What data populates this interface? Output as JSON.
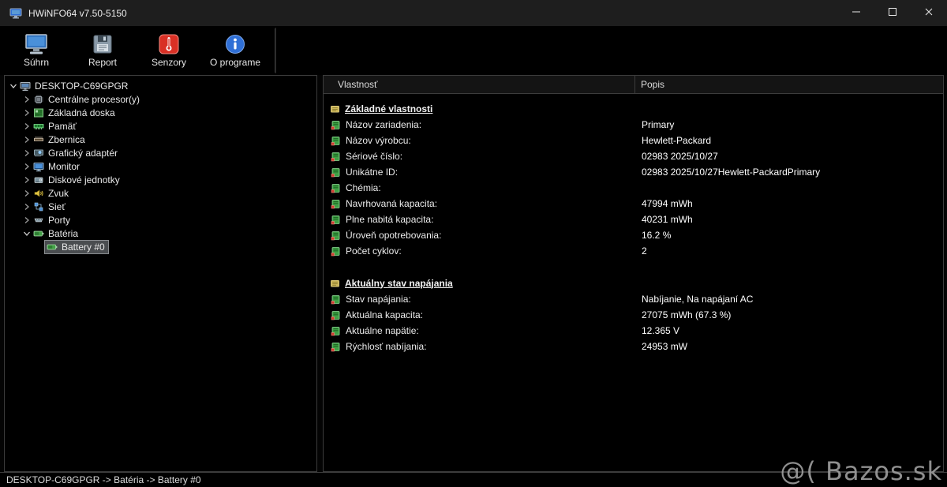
{
  "window": {
    "title": "HWiNFO64 v7.50-5150",
    "app_icon": "app-icon",
    "controls": [
      {
        "name": "minimize",
        "icon": "minimize-icon"
      },
      {
        "name": "maximize",
        "icon": "maximize-icon"
      },
      {
        "name": "close",
        "icon": "close-icon"
      }
    ]
  },
  "toolbar": {
    "buttons": [
      {
        "label": "Súhrn",
        "icon": "summary-icon"
      },
      {
        "label": "Report",
        "icon": "report-icon"
      },
      {
        "label": "Senzory",
        "icon": "sensors-icon"
      },
      {
        "label": "O programe",
        "icon": "about-icon"
      }
    ]
  },
  "tree": {
    "items": [
      {
        "label": "DESKTOP-C69GPGR",
        "level": 0,
        "state": "expanded",
        "icon": "computer-icon",
        "selected": false
      },
      {
        "label": "Centrálne procesor(y)",
        "level": 1,
        "state": "collapsed",
        "icon": "cpu-icon",
        "selected": false
      },
      {
        "label": "Základná doska",
        "level": 1,
        "state": "collapsed",
        "icon": "motherboard-icon",
        "selected": false
      },
      {
        "label": "Pamäť",
        "level": 1,
        "state": "collapsed",
        "icon": "memory-icon",
        "selected": false
      },
      {
        "label": "Zbernica",
        "level": 1,
        "state": "collapsed",
        "icon": "bus-icon",
        "selected": false
      },
      {
        "label": "Grafický adaptér",
        "level": 1,
        "state": "collapsed",
        "icon": "gpu-icon",
        "selected": false
      },
      {
        "label": "Monitor",
        "level": 1,
        "state": "collapsed",
        "icon": "monitor-icon",
        "selected": false
      },
      {
        "label": "Diskové jednotky",
        "level": 1,
        "state": "collapsed",
        "icon": "disk-icon",
        "selected": false
      },
      {
        "label": "Zvuk",
        "level": 1,
        "state": "collapsed",
        "icon": "sound-icon",
        "selected": false
      },
      {
        "label": "Sieť",
        "level": 1,
        "state": "collapsed",
        "icon": "network-icon",
        "selected": false
      },
      {
        "label": "Porty",
        "level": 1,
        "state": "collapsed",
        "icon": "ports-icon",
        "selected": false
      },
      {
        "label": "Batéria",
        "level": 1,
        "state": "expanded",
        "icon": "battery-icon",
        "selected": false
      },
      {
        "label": "Battery #0",
        "level": 2,
        "state": "leaf",
        "icon": "battery-icon",
        "selected": true
      }
    ]
  },
  "details": {
    "columns": [
      "Vlastnosť",
      "Popis"
    ],
    "section_icon": "folder-icon",
    "row_icon": "prop-icon",
    "sections": [
      {
        "title": "Základné vlastnosti",
        "rows": [
          {
            "property": "Názov zariadenia:",
            "value": "Primary"
          },
          {
            "property": "Názov výrobcu:",
            "value": "Hewlett-Packard"
          },
          {
            "property": "Sériové číslo:",
            "value": "02983 2025/10/27"
          },
          {
            "property": "Unikátne ID:",
            "value": "02983 2025/10/27Hewlett-PackardPrimary"
          },
          {
            "property": "Chémia:",
            "value": ""
          },
          {
            "property": "Navrhovaná kapacita:",
            "value": "47994 mWh"
          },
          {
            "property": "Plne nabitá kapacita:",
            "value": "40231 mWh"
          },
          {
            "property": "Úroveň opotrebovania:",
            "value": "16.2 %"
          },
          {
            "property": "Počet cyklov:",
            "value": "2"
          }
        ]
      },
      {
        "title": "Aktuálny stav napájania",
        "rows": [
          {
            "property": "Stav napájania:",
            "value": "Nabíjanie, Na napájaní AC"
          },
          {
            "property": "Aktuálna kapacita:",
            "value": "27075 mWh (67.3 %)"
          },
          {
            "property": "Aktuálne napätie:",
            "value": "12.365 V"
          },
          {
            "property": "Rýchlosť nabíjania:",
            "value": "24953 mW"
          }
        ]
      }
    ]
  },
  "statusbar": {
    "text": "DESKTOP-C69GPGR -> Batéria -> Battery #0"
  },
  "watermark": {
    "text": "@( Bazos.sk"
  }
}
